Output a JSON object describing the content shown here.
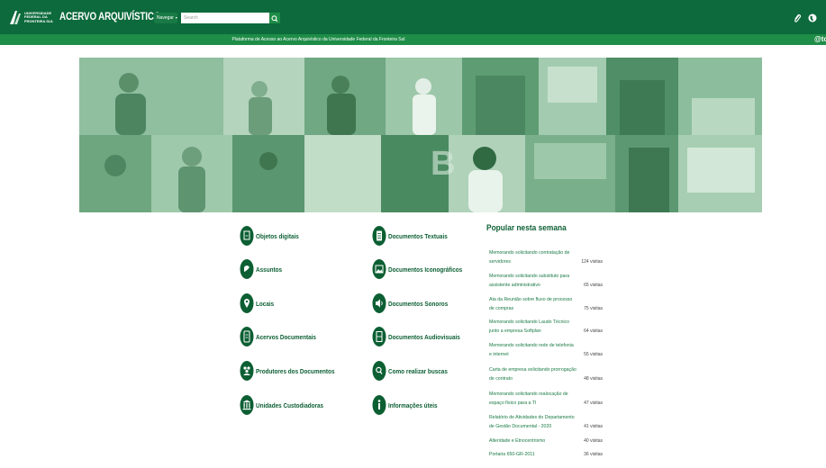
{
  "header": {
    "logo_text": "UNIVERSIDADE FEDERAL DA FRONTEIRA SUL",
    "site_title": "ACERVO ARQUIVÍSTICO",
    "nav_label": "Navegar",
    "search_placeholder": "Search",
    "subtitle": "Plataforma de Acesso ao Acervo Arquivístico da Universidade Federal da Fronteira Sul",
    "cut_text": "@tc",
    "colors": {
      "primary": "#0c6a3c",
      "secondary": "#1e8d47",
      "text_green": "#0c5f33"
    }
  },
  "categories_left": [
    {
      "label": "Objetos digitais",
      "icon": "digital-object-icon"
    },
    {
      "label": "Assuntos",
      "icon": "subject-tag-icon"
    },
    {
      "label": "Locais",
      "icon": "map-pin-icon"
    },
    {
      "label": "Acervos Documentais",
      "icon": "archive-icon"
    },
    {
      "label": "Produtores dos Documentos",
      "icon": "people-icon"
    },
    {
      "label": "Unidades Custodiadoras",
      "icon": "institution-icon"
    }
  ],
  "categories_right": [
    {
      "label": "Documentos Textuais",
      "icon": "text-document-icon"
    },
    {
      "label": "Documentos Iconográficos",
      "icon": "image-icon"
    },
    {
      "label": "Documentos Sonoros",
      "icon": "speaker-icon"
    },
    {
      "label": "Documentos Audiovisuais",
      "icon": "film-icon"
    },
    {
      "label": "Como realizar buscas",
      "icon": "search-icon"
    },
    {
      "label": "Informações úteis",
      "icon": "info-icon"
    }
  ],
  "popular": {
    "title": "Popular nesta semana",
    "items": [
      {
        "title": "Memorando solicitando contratação de servidores",
        "visits": "124 visitas"
      },
      {
        "title": "Memorando solicitando substituto para assistente administrativo",
        "visits": "65 visitas"
      },
      {
        "title": "Ata da Reunião sobre fluxo de processo de compras",
        "visits": "75 visitas"
      },
      {
        "title": "Memorando solicitando Laudo Técnico junto a empresa Softplan",
        "visits": "64 visitas"
      },
      {
        "title": "Memorando solicitando rede de telefonia e internet",
        "visits": "55 visitas"
      },
      {
        "title": "Carta de empresa solicitando prorrogação de contrato",
        "visits": "48 visitas"
      },
      {
        "title": "Memorando solicitando realocação de espaço físico para a TI",
        "visits": "47 visitas"
      },
      {
        "title": "Relatório de Atividades do Departamento de Gestão Documental - 2020",
        "visits": "41 visitas"
      },
      {
        "title": "Alteridade e Etnocentrismo",
        "visits": "40 visitas"
      },
      {
        "title": "Portaria 650-GR-2011",
        "visits": "36 visitas"
      }
    ]
  }
}
